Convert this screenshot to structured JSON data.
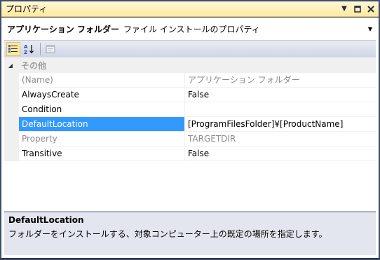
{
  "window": {
    "title": "プロパティ"
  },
  "object_selector": {
    "name": "アプリケーション フォルダー",
    "type": "ファイル インストールのプロパティ"
  },
  "toolbar": {
    "categorized_icon": "categorized-icon",
    "alphabetical_icon": "alphabetical-icon",
    "property_pages_icon": "property-pages-icon"
  },
  "grid": {
    "category": "その他",
    "rows": [
      {
        "name": "(Name)",
        "value": "アプリケーション フォルダー"
      },
      {
        "name": "AlwaysCreate",
        "value": "False"
      },
      {
        "name": "Condition",
        "value": ""
      },
      {
        "name": "DefaultLocation",
        "value": "[ProgramFilesFolder]¥[ProductName]"
      },
      {
        "name": "Property",
        "value": "TARGETDIR"
      },
      {
        "name": "Transitive",
        "value": "False"
      }
    ]
  },
  "description": {
    "title": "DefaultLocation",
    "text": "フォルダーをインストールする、対象コンピューター上の既定の場所を指定します。"
  },
  "colors": {
    "title_bar": "#ffe9a1",
    "selected": "#3399ff",
    "frame": "#293955"
  }
}
